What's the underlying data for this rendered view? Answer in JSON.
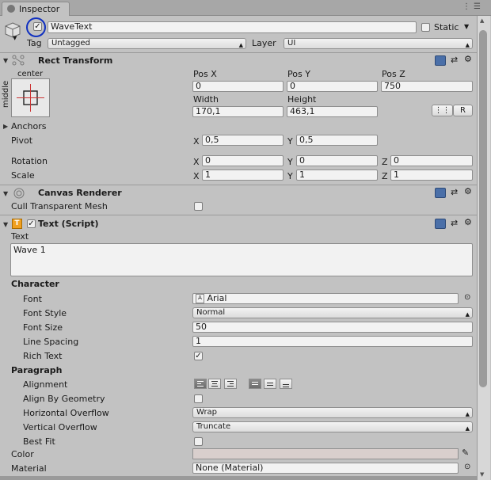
{
  "tab": {
    "label": "Inspector"
  },
  "object": {
    "name": "WaveText",
    "static_label": "Static",
    "tag_label": "Tag",
    "tag_value": "Untagged",
    "layer_label": "Layer",
    "layer_value": "UI"
  },
  "rect_transform": {
    "title": "Rect Transform",
    "anchor_h": "center",
    "anchor_v": "middle",
    "posx_label": "Pos X",
    "posy_label": "Pos Y",
    "posz_label": "Pos Z",
    "posx": "0",
    "posy": "0",
    "posz": "750",
    "width_label": "Width",
    "height_label": "Height",
    "width": "170,1",
    "height": "463,1",
    "r_button": "R",
    "anchors_label": "Anchors",
    "pivot_label": "Pivot",
    "pivot_x": "0,5",
    "pivot_y": "0,5",
    "rotation_label": "Rotation",
    "rot_x": "0",
    "rot_y": "0",
    "rot_z": "0",
    "scale_label": "Scale",
    "scale_x": "1",
    "scale_y": "1",
    "scale_z": "1",
    "x": "X",
    "y": "Y",
    "z": "Z"
  },
  "canvas_renderer": {
    "title": "Canvas Renderer",
    "cull_label": "Cull Transparent Mesh"
  },
  "text_script": {
    "title": "Text (Script)",
    "text_label": "Text",
    "text_value": "Wave 1",
    "character_label": "Character",
    "font_label": "Font",
    "font_value": "Arial",
    "font_style_label": "Font Style",
    "font_style_value": "Normal",
    "font_size_label": "Font Size",
    "font_size_value": "50",
    "line_spacing_label": "Line Spacing",
    "line_spacing_value": "1",
    "rich_text_label": "Rich Text",
    "paragraph_label": "Paragraph",
    "alignment_label": "Alignment",
    "align_geom_label": "Align By Geometry",
    "h_overflow_label": "Horizontal Overflow",
    "h_overflow_value": "Wrap",
    "v_overflow_label": "Vertical Overflow",
    "v_overflow_value": "Truncate",
    "best_fit_label": "Best Fit",
    "color_label": "Color",
    "material_label": "Material",
    "material_value": "None (Material)"
  },
  "icons": [
    "cube-icon",
    "help-icon",
    "preset-icon",
    "gear-icon",
    "rect-transform-icon",
    "canvas-renderer-icon",
    "text-component-icon",
    "eyedropper-icon",
    "object-picker-icon"
  ],
  "colors": {
    "panel": "#c2c2c2",
    "text_color_swatch": "#d9cfcd",
    "highlight_circle": "#1030c0"
  }
}
